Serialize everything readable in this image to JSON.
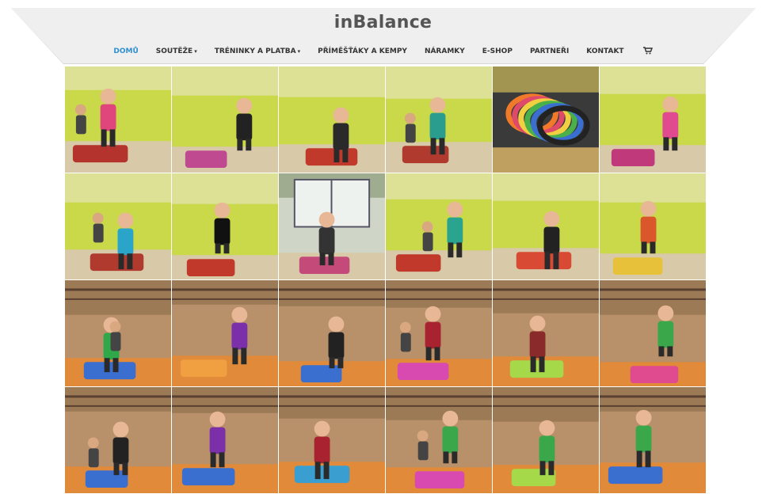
{
  "site": {
    "title": "inBalance",
    "accent_color": "#2f8fd0"
  },
  "nav": {
    "items": [
      {
        "label": "DOMŮ",
        "active": true,
        "dropdown": false
      },
      {
        "label": "SOUTĚŽE",
        "active": false,
        "dropdown": true
      },
      {
        "label": "TRÉNINKY A PLATBA",
        "active": false,
        "dropdown": true
      },
      {
        "label": "PŘÍMĚŠŤÁKY A KEMPY",
        "active": false,
        "dropdown": false
      },
      {
        "label": "NÁRAMKY",
        "active": false,
        "dropdown": false
      },
      {
        "label": "E-SHOP",
        "active": false,
        "dropdown": false
      },
      {
        "label": "PARTNEŘI",
        "active": false,
        "dropdown": false
      },
      {
        "label": "KONTAKT",
        "active": false,
        "dropdown": false
      }
    ],
    "cart_icon": "cart-icon"
  },
  "gallery": {
    "photos": [
      {
        "scene": "green-gym",
        "figure": "#e0457b",
        "mat": "#b5332d"
      },
      {
        "scene": "green-gym",
        "figure": "#222222",
        "mat": "#c04a8f"
      },
      {
        "scene": "green-gym",
        "figure": "#2a2a2a",
        "mat": "#c0392b"
      },
      {
        "scene": "green-gym",
        "figure": "#2a9d8f",
        "mat": "#b03a2e"
      },
      {
        "scene": "wristbands",
        "figure": "#f07a2a",
        "mat": "#e8e060"
      },
      {
        "scene": "green-gym",
        "figure": "#e04a8f",
        "mat": "#c0397a"
      },
      {
        "scene": "green-gym",
        "figure": "#2ba4c9",
        "mat": "#b03a2e"
      },
      {
        "scene": "green-gym",
        "figure": "#111111",
        "mat": "#c0392b"
      },
      {
        "scene": "window-gym",
        "figure": "#333333",
        "mat": "#c44a7a"
      },
      {
        "scene": "green-gym",
        "figure": "#2aa38f",
        "mat": "#c0392b"
      },
      {
        "scene": "green-gym",
        "figure": "#222222",
        "mat": "#d94a35"
      },
      {
        "scene": "green-gym",
        "figure": "#d9572b",
        "mat": "#e8c13a"
      },
      {
        "scene": "wood-gym",
        "figure": "#2fa84a",
        "mat": "#3a6fd0"
      },
      {
        "scene": "wood-gym",
        "figure": "#7b2fa8",
        "mat": "#f0a040"
      },
      {
        "scene": "wood-gym",
        "figure": "#222222",
        "mat": "#3a6fd0"
      },
      {
        "scene": "wood-gym",
        "figure": "#a8232f",
        "mat": "#d94ab0"
      },
      {
        "scene": "wood-gym",
        "figure": "#8a2a2a",
        "mat": "#a6d94a"
      },
      {
        "scene": "wood-gym",
        "figure": "#3aa84a",
        "mat": "#e04a8f"
      },
      {
        "scene": "wood-gym",
        "figure": "#222222",
        "mat": "#3a6fd0"
      },
      {
        "scene": "wood-gym",
        "figure": "#7b2fa8",
        "mat": "#3a6fd0"
      },
      {
        "scene": "wood-gym",
        "figure": "#a8232f",
        "mat": "#3a9fd0"
      },
      {
        "scene": "wood-gym",
        "figure": "#3aa84a",
        "mat": "#d94ab0"
      },
      {
        "scene": "wood-gym",
        "figure": "#3aa84a",
        "mat": "#a6d94a"
      },
      {
        "scene": "wood-gym",
        "figure": "#3aa84a",
        "mat": "#3a6fd0"
      }
    ]
  }
}
